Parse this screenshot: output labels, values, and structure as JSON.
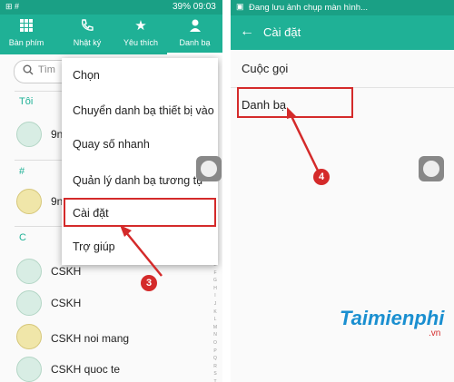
{
  "left": {
    "status": {
      "app_icon": "app-icon",
      "right_text": "39% 09:03"
    },
    "tabs": [
      {
        "label": "Bàn phím",
        "icon": "keypad-icon"
      },
      {
        "label": "Nhật ký",
        "icon": "call-log-icon"
      },
      {
        "label": "Yêu thích",
        "icon": "star-icon"
      },
      {
        "label": "Danh bạ",
        "icon": "contacts-icon"
      }
    ],
    "search_placeholder": "Tìm",
    "sections": {
      "me": "Tôi",
      "hash": "#",
      "c": "C"
    },
    "contacts": [
      "9n",
      "9n",
      "CSKH",
      "CSKH",
      "CSKH noi mang",
      "CSKH quoc te"
    ],
    "alphabet": [
      "E",
      "F",
      "G",
      "H",
      "I",
      "J",
      "K",
      "L",
      "M",
      "N",
      "O",
      "P",
      "Q",
      "R",
      "S",
      "T",
      "U"
    ],
    "menu": {
      "items": [
        "Chọn",
        "Chuyển danh bạ thiết bị vào",
        "Quay số nhanh",
        "Quản lý danh bạ tương tự",
        "Cài đặt",
        "Trợ giúp"
      ]
    },
    "badge": "3"
  },
  "right": {
    "status_text": "Đang lưu ảnh chụp màn hình...",
    "header_title": "Cài đặt",
    "items": [
      "Cuộc gọi",
      "Danh bạ"
    ],
    "badge": "4"
  },
  "watermark": {
    "brand": "Taimienphi",
    "suffix": ".vn"
  },
  "colors": {
    "accent": "#1fb196",
    "status": "#1aa085",
    "highlight": "#d42a2a"
  }
}
